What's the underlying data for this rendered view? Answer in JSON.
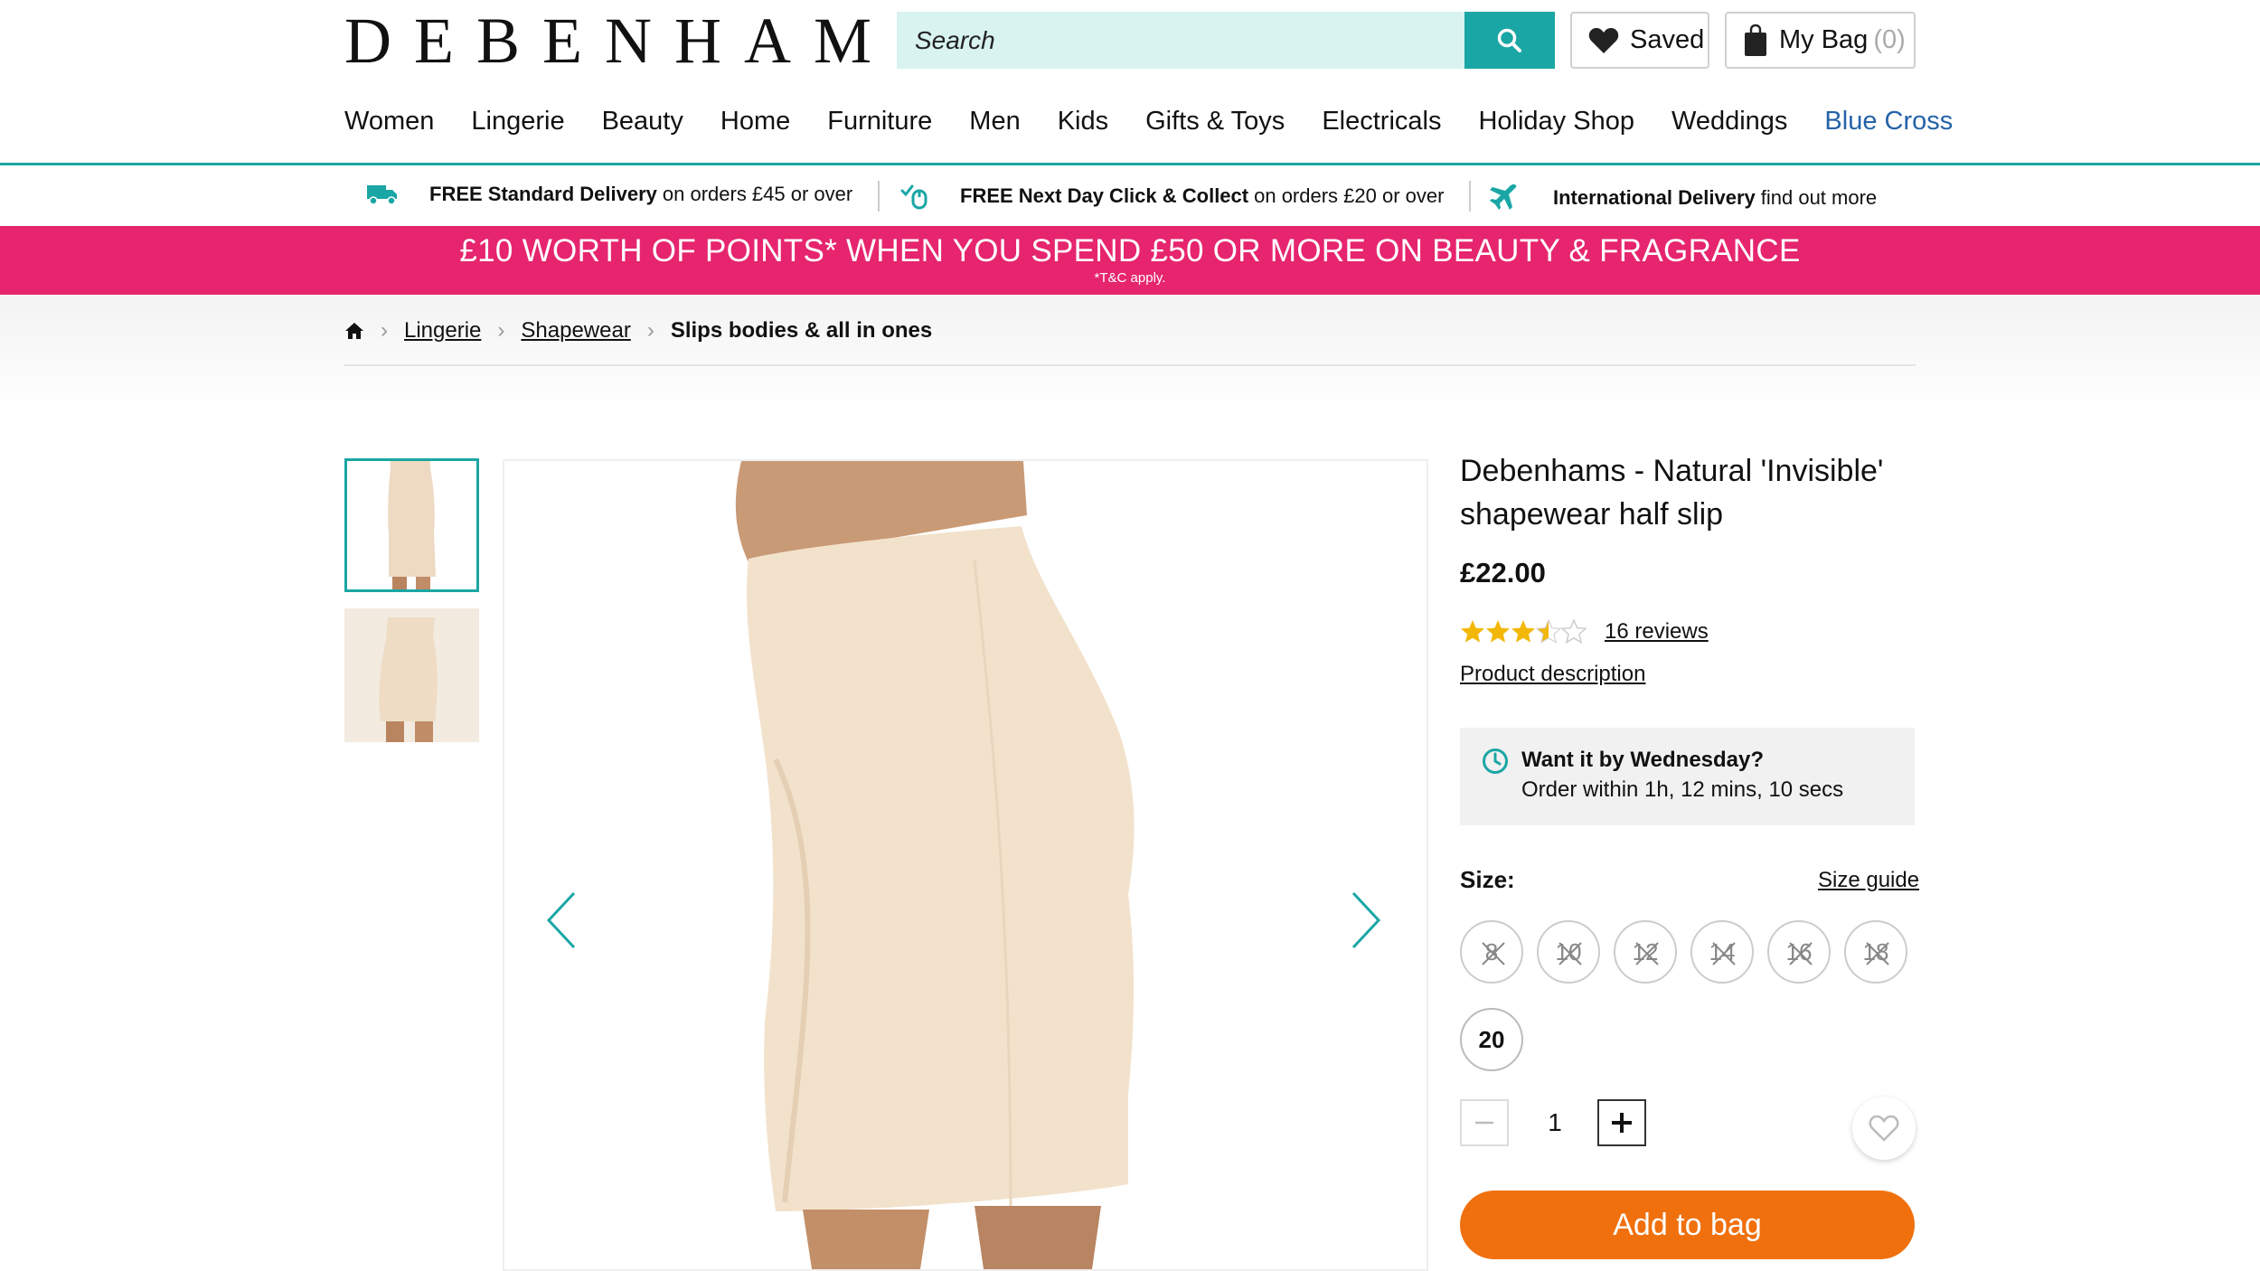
{
  "header": {
    "logo": "DEBENHAMS",
    "search_placeholder": "Search",
    "saved_label": "Saved",
    "bag_label": "My Bag",
    "bag_count": "(0)"
  },
  "nav": {
    "items": [
      "Women",
      "Lingerie",
      "Beauty",
      "Home",
      "Furniture",
      "Men",
      "Kids",
      "Gifts & Toys",
      "Electricals",
      "Holiday Shop",
      "Weddings",
      "Blue Cross"
    ]
  },
  "delivery": {
    "item1_bold": "FREE Standard Delivery",
    "item1_text": "on orders £45 or over",
    "item2_bold": "FREE Next Day Click & Collect",
    "item2_text": "on orders £20 or over",
    "item3_bold": "International Delivery",
    "item3_text": "find out more"
  },
  "promo": {
    "main": "£10 WORTH OF POINTS* WHEN YOU SPEND £50 OR MORE ON BEAUTY & FRAGRANCE",
    "sub": "*T&C apply."
  },
  "breadcrumb": {
    "items": [
      "Lingerie",
      "Shapewear"
    ],
    "current": "Slips bodies & all in ones"
  },
  "product": {
    "title": "Debenhams - Natural 'Invisible' shapewear half slip",
    "price": "£22.00",
    "rating": 3.5,
    "rating_max": 5,
    "reviews": "16 reviews",
    "description_link": "Product description",
    "delivery_title": "Want it by Wednesday?",
    "delivery_text": "Order within 1h, 12 mins, 10 secs",
    "size_label": "Size:",
    "size_guide": "Size guide",
    "sizes": [
      {
        "label": "8",
        "available": false
      },
      {
        "label": "10",
        "available": false
      },
      {
        "label": "12",
        "available": false
      },
      {
        "label": "14",
        "available": false
      },
      {
        "label": "16",
        "available": false
      },
      {
        "label": "18",
        "available": false
      },
      {
        "label": "20",
        "available": true
      }
    ],
    "quantity": "1",
    "add_to_bag": "Add to bag"
  },
  "colors": {
    "teal": "#1aa6a4",
    "promo_pink": "#e6256e",
    "cta_orange": "#f0700e",
    "star": "#f2b707",
    "blue_link": "#2563a8"
  }
}
